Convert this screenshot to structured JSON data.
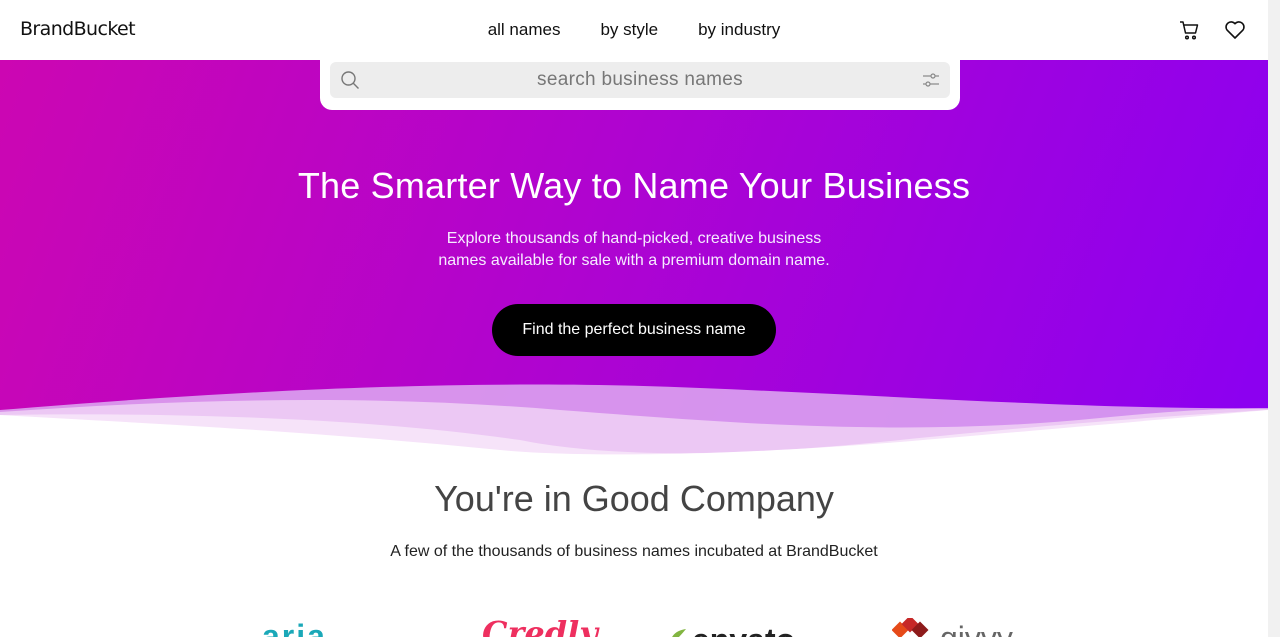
{
  "header": {
    "logo": "BrandBucket",
    "nav": [
      {
        "label": "all names"
      },
      {
        "label": "by style"
      },
      {
        "label": "by industry"
      }
    ],
    "icons": [
      "cart-icon",
      "heart-icon"
    ]
  },
  "search": {
    "placeholder": "search business names",
    "icon": "search-icon",
    "filter_icon": "filter-sliders-icon"
  },
  "hero": {
    "title": "The Smarter Way to Name Your Business",
    "subtitle": "Explore thousands of hand-picked, creative business names available for sale with a premium domain name.",
    "cta_label": "Find the perfect business name",
    "gradient": [
      "#cc06b2",
      "#8a00f2"
    ]
  },
  "company": {
    "title": "You're in Good Company",
    "subtitle": "A few of the thousands of business names incubated at BrandBucket",
    "logos": [
      {
        "name": "aria",
        "text": "aria"
      },
      {
        "name": "credly",
        "text": "Credly"
      },
      {
        "name": "envato",
        "text": "envato"
      },
      {
        "name": "givvy",
        "text": "givvy"
      }
    ]
  },
  "colors": {
    "cta_bg": "#000000",
    "hero_text": "#ffffff",
    "heading_gray": "#444444"
  }
}
